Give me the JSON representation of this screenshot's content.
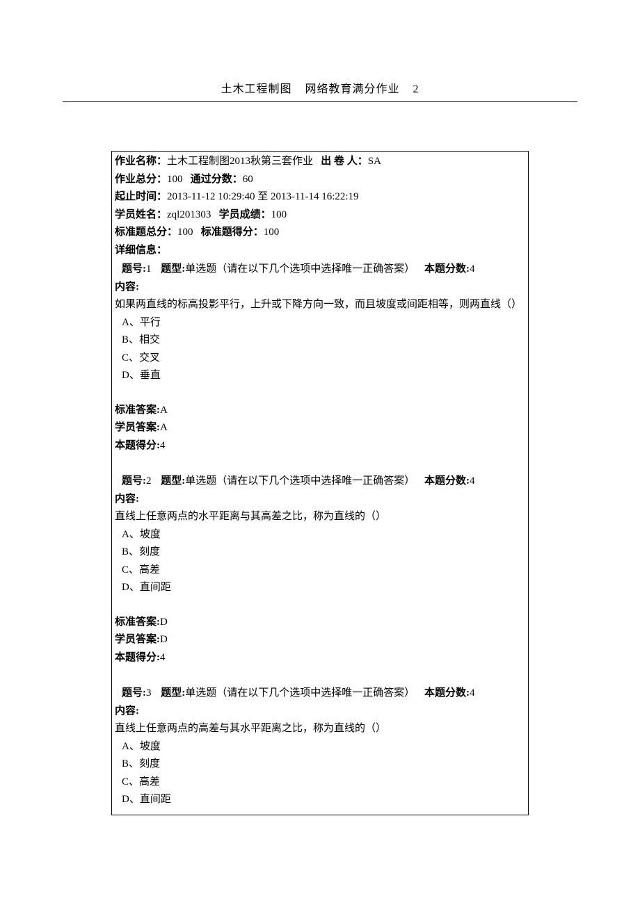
{
  "header": {
    "title_part1": "土木工程制图",
    "title_part2": "网络教育满分作业",
    "title_num": "2"
  },
  "meta": {
    "hw_name_label": "作业名称：",
    "hw_name": "土木工程制图2013秋第三套作业",
    "issuer_label": "出 卷 人：",
    "issuer": "SA",
    "total_label": "作业总分：",
    "total": "100",
    "pass_label": "通过分数：",
    "pass": "60",
    "time_label": "起止时间：",
    "time": "2013-11-12 10:29:40 至 2013-11-14 16:22:19",
    "student_name_label": "学员姓名：",
    "student_name": "zql201303",
    "student_score_label": "学员成绩：",
    "student_score": "100",
    "std_total_label": "标准题总分：",
    "std_total": "100",
    "std_score_label": "标准题得分：",
    "std_score": "100",
    "detail_label": "详细信息："
  },
  "labels": {
    "qnum": "题号:",
    "qtype": "题型:",
    "qtype_text": "单选题（请在以下几个选项中选择唯一正确答案）",
    "qscore": "本题分数:",
    "content": "内容:",
    "std_ans": "标准答案:",
    "stu_ans": "学员答案:",
    "got": "本题得分:"
  },
  "questions": [
    {
      "num": "1",
      "score": "4",
      "stem": "如果两直线的标高投影平行，上升或下降方向一致，而且坡度或间距相等，则两直线（）",
      "options": [
        "A、平行",
        "B、相交",
        "C、交叉",
        "D、垂直"
      ],
      "std_ans": "A",
      "stu_ans": "A",
      "got": "4"
    },
    {
      "num": "2",
      "score": "4",
      "stem": "直线上任意两点的水平距离与其高差之比，称为直线的（）",
      "options": [
        "A、坡度",
        "B、刻度",
        "C、高差",
        "D、直间距"
      ],
      "std_ans": "D",
      "stu_ans": "D",
      "got": "4"
    },
    {
      "num": "3",
      "score": "4",
      "stem": "直线上任意两点的高差与其水平距离之比，称为直线的（）",
      "options": [
        "A、坡度",
        "B、刻度",
        "C、高差",
        "D、直间距"
      ]
    }
  ]
}
